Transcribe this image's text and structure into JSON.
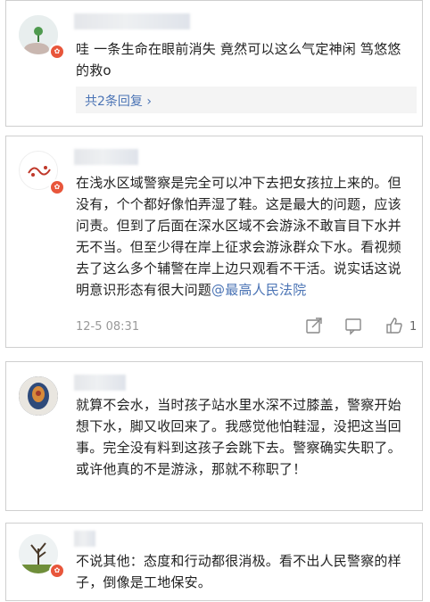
{
  "comments": [
    {
      "text": "哇 一条生命在眼前消失 竟然可以这么气定神闲 笃悠悠的救o",
      "reply_link": "共2条回复",
      "reply_chevron": "›"
    },
    {
      "text_main": "在浅水区域警察是完全可以冲下去把女孩拉上来的。但没有，个个都好像怕弄湿了鞋。这是最大的问题，应该问责。但到了后面在深水区域不会游泳不敢盲目下水并无不当。但至少得在岸上征求会游泳群众下水。看视频去了这么多个辅警在岸上边只观看不干活。说实话这说明意识形态有很大问题",
      "mention": "@最高人民法院",
      "time": "12-5 08:31",
      "like_count": "1"
    },
    {
      "text": "就算不会水，当时孩子站水里水深不过膝盖，警察开始想下水，脚又收回来了。我感觉他怕鞋湿，没把这当回事。完全没有料到这孩子会跳下去。警察确实失职了。或许他真的不是游泳，那就不称职了！"
    },
    {
      "text": "不说其他：态度和行动都很消极。看不出人民警察的样子，倒像是工地保安。"
    }
  ],
  "icons": {
    "verified": "verified-badge-icon",
    "share": "share-icon",
    "comment": "comment-icon",
    "like": "thumbs-up-icon"
  },
  "colors": {
    "link": "#4b74b5",
    "badge": "#e8563b",
    "reply_bg": "#f4f4f4"
  }
}
